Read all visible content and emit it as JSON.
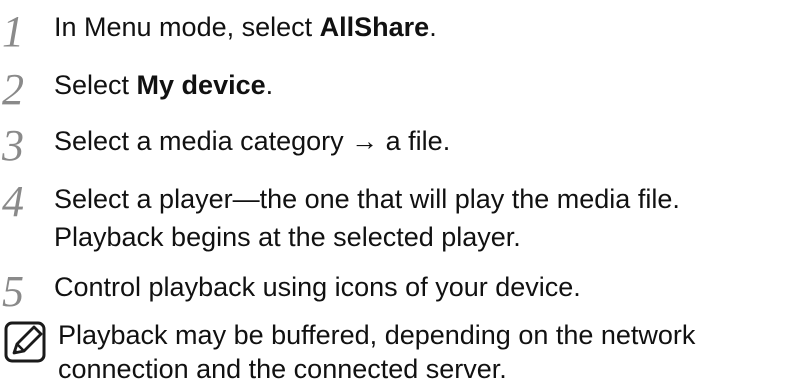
{
  "steps": [
    {
      "number": "1",
      "text_before": "In Menu mode, select ",
      "bold": "AllShare",
      "text_after": "."
    },
    {
      "number": "2",
      "text_before": "Select ",
      "bold": "My device",
      "text_after": "."
    },
    {
      "number": "3",
      "text": "Select a media category → a file."
    },
    {
      "number": "4",
      "line1": "Select a player—the one that will play the media file.",
      "line2": "Playback begins at the selected player."
    },
    {
      "number": "5",
      "text": "Control playback using icons of your device."
    }
  ],
  "note": {
    "icon": "note-pencil-icon",
    "line1": "Playback may be buffered, depending on the network",
    "line2": "connection and the connected server."
  }
}
